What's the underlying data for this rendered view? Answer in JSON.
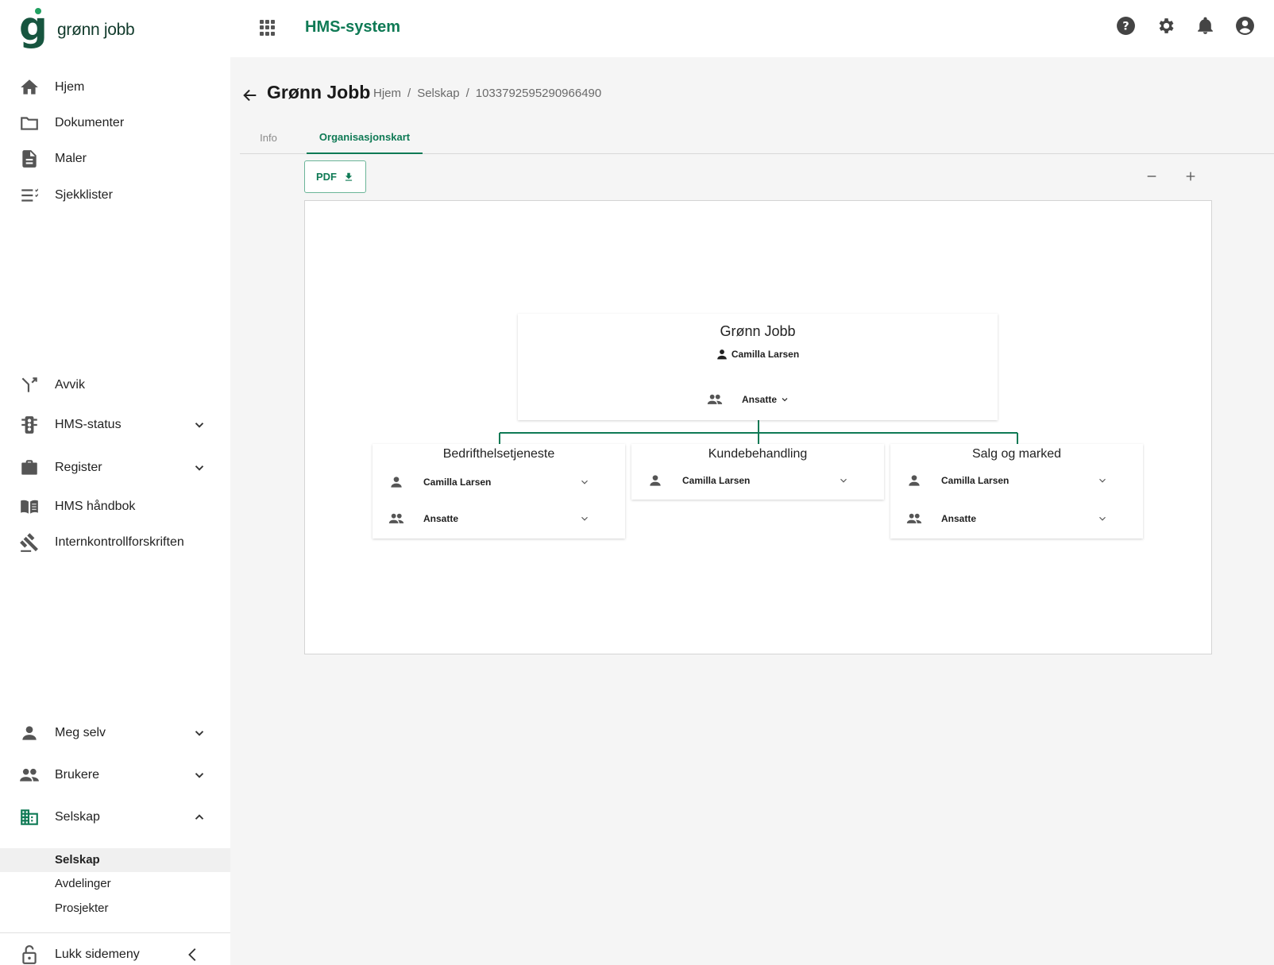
{
  "header": {
    "logo_text": "grønn jobb",
    "app_title": "HMS-system"
  },
  "sidebar": {
    "items": [
      {
        "label": "Hjem"
      },
      {
        "label": "Dokumenter"
      },
      {
        "label": "Maler"
      },
      {
        "label": "Sjekklister"
      },
      {
        "label": "Avvik"
      },
      {
        "label": "HMS-status"
      },
      {
        "label": "Register"
      },
      {
        "label": "HMS håndbok"
      },
      {
        "label": "Internkontrollforskriften"
      },
      {
        "label": "Meg selv"
      },
      {
        "label": "Brukere"
      },
      {
        "label": "Selskap"
      }
    ],
    "subitems": [
      {
        "label": "Selskap"
      },
      {
        "label": "Avdelinger"
      },
      {
        "label": "Prosjekter"
      }
    ],
    "collapse_label": "Lukk sidemeny"
  },
  "page": {
    "title": "Grønn Jobb",
    "breadcrumb": [
      "Hjem",
      "/",
      "Selskap",
      "/",
      "1033792595290966490"
    ]
  },
  "tabs": [
    {
      "label": "Info"
    },
    {
      "label": "Organisasjonskart"
    }
  ],
  "toolbar": {
    "pdf_label": "PDF"
  },
  "org_chart": {
    "root": {
      "title": "Grønn Jobb",
      "manager": "Camilla Larsen",
      "employees_label": "Ansatte"
    },
    "departments": [
      {
        "title": "Bedrifthelsetjeneste",
        "manager": "Camilla Larsen",
        "employees_label": "Ansatte"
      },
      {
        "title": "Kundebehandling",
        "manager": "Camilla Larsen"
      },
      {
        "title": "Salg og marked",
        "manager": "Camilla Larsen",
        "employees_label": "Ansatte"
      }
    ],
    "line_color": "#0f7a55"
  },
  "colors": {
    "accent": "#0f7a55",
    "brand_dark": "#17553f"
  }
}
